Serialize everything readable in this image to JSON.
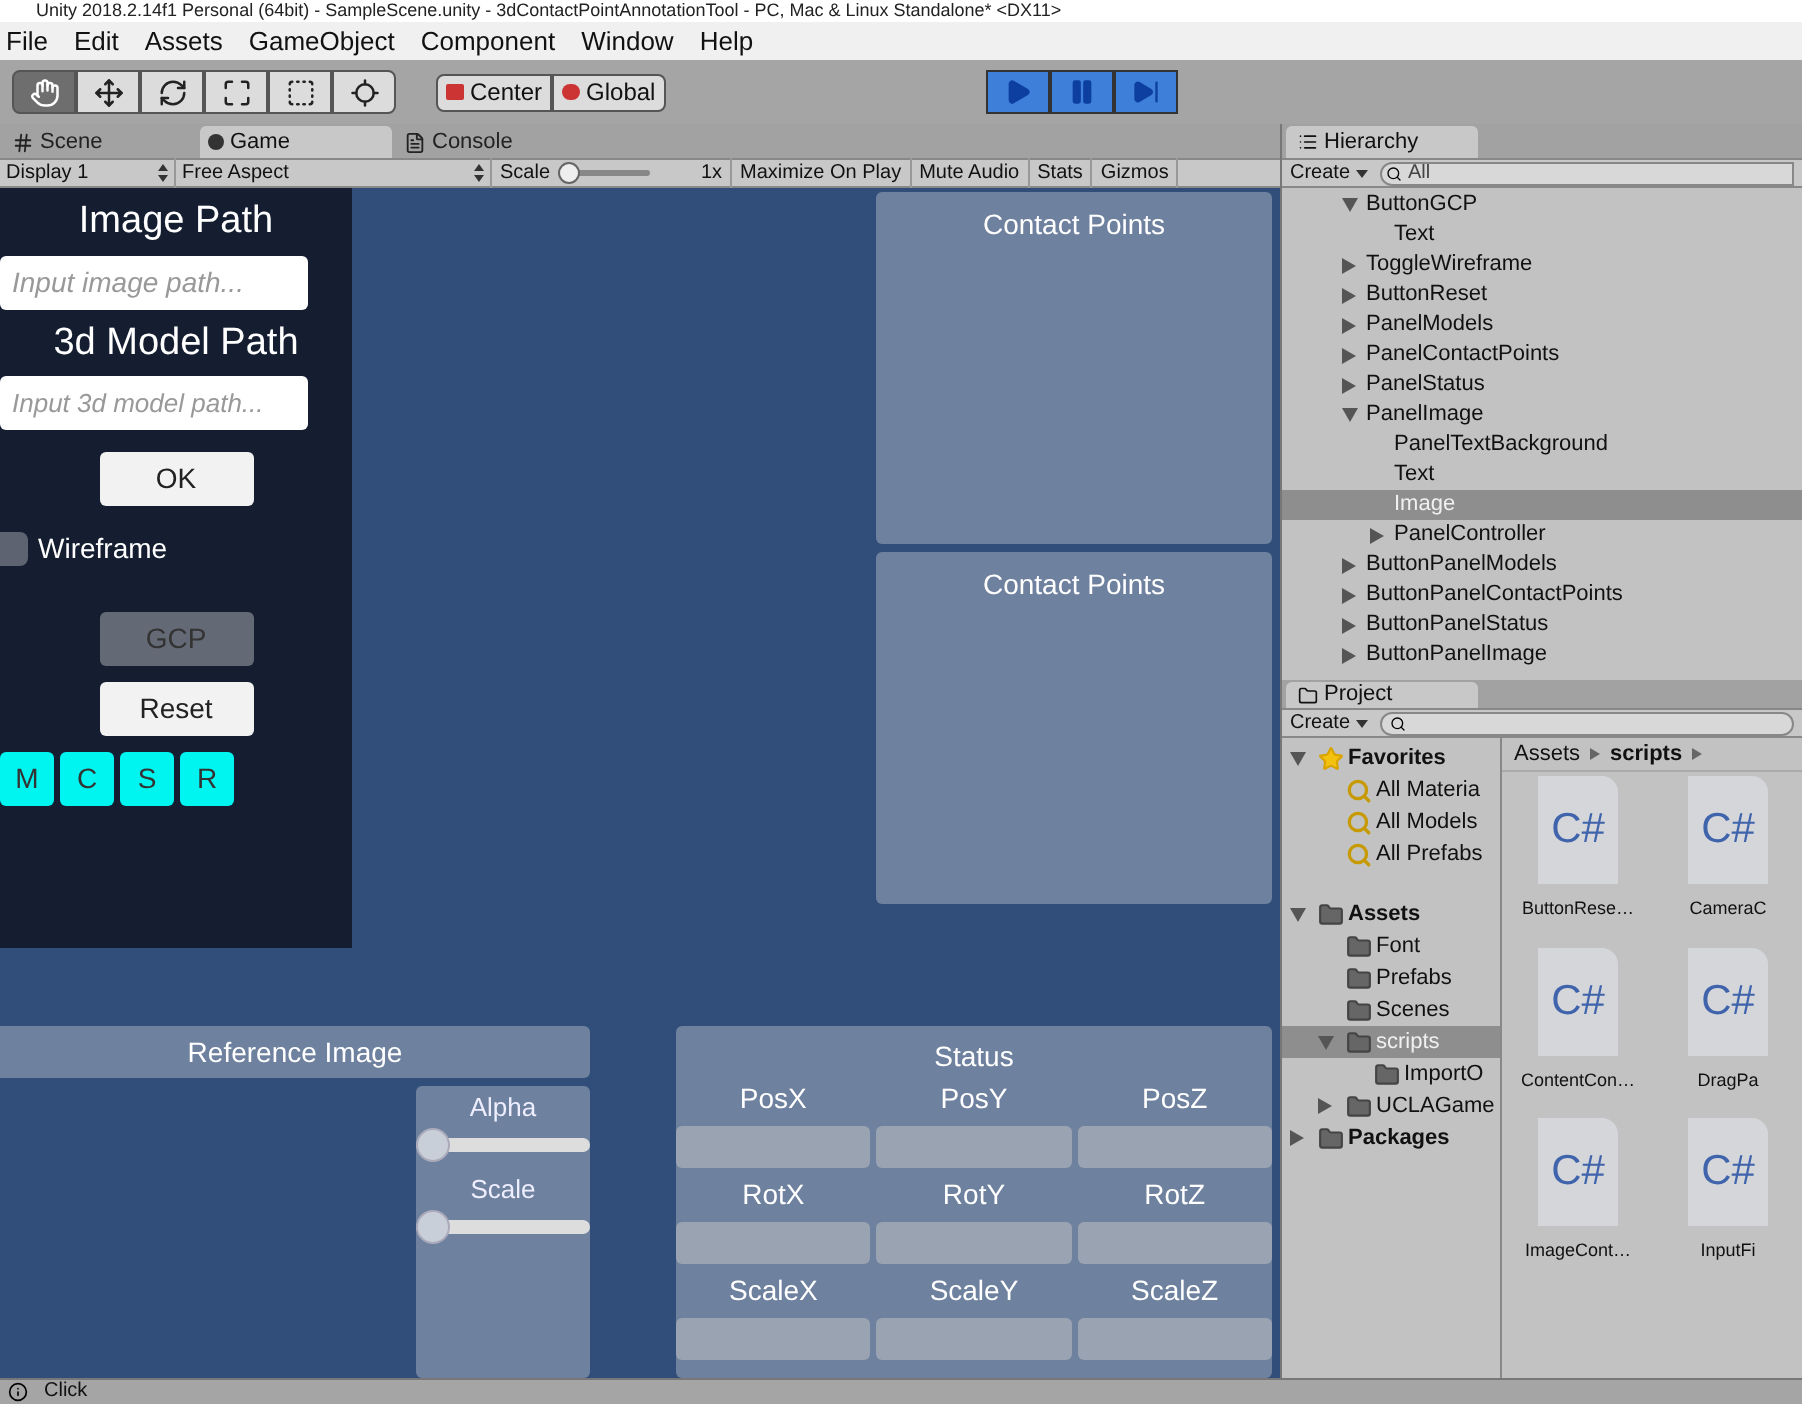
{
  "window": {
    "title": "Unity 2018.2.14f1 Personal (64bit) - SampleScene.unity - 3dContactPointAnnotationTool - PC, Mac & Linux Standalone* <DX11>"
  },
  "menu": [
    "File",
    "Edit",
    "Assets",
    "GameObject",
    "Component",
    "Window",
    "Help"
  ],
  "tools": [
    {
      "kind": "hand",
      "selected": true
    },
    {
      "kind": "move",
      "selected": false
    },
    {
      "kind": "rotate",
      "selected": false
    },
    {
      "kind": "scale",
      "selected": false
    },
    {
      "kind": "rect",
      "selected": false
    },
    {
      "kind": "transform",
      "selected": false
    }
  ],
  "pivot_buttons": [
    {
      "kind": "pivot",
      "label": "Center"
    },
    {
      "kind": "space",
      "label": "Global"
    }
  ],
  "play_controls": [
    {
      "kind": "play",
      "on": true
    },
    {
      "kind": "pause",
      "on": true
    },
    {
      "kind": "step",
      "on": true
    }
  ],
  "view_tabs": [
    {
      "kind": "scene",
      "label": "Scene",
      "selected": false
    },
    {
      "kind": "game",
      "label": "Game",
      "selected": true
    },
    {
      "kind": "console",
      "label": "Console",
      "selected": false
    }
  ],
  "game_toolbar": {
    "display": "Display 1",
    "aspect": "Free Aspect",
    "scale_label": "Scale",
    "scale": {
      "level": 0
    },
    "scale_reading": "1x",
    "buttons": [
      "Maximize On Play",
      "Mute Audio",
      "Stats",
      "Gizmos"
    ]
  },
  "game": {
    "image_path_label": "Image Path",
    "image_path": {
      "placeholder": "Input image path..."
    },
    "model_path_label": "3d Model Path",
    "model_path": {
      "placeholder": "Input 3d model path..."
    },
    "ok": "OK",
    "wireframe": {
      "label": "Wireframe",
      "checked": false
    },
    "gcp": {
      "label": "GCP",
      "disabled": true
    },
    "reset": {
      "label": "Reset",
      "disabled": false
    },
    "panel_buttons": [
      "M",
      "C",
      "S",
      "R"
    ],
    "contact_panels": [
      "Contact Points",
      "Contact Points"
    ],
    "reference_image": "Reference Image",
    "sliders": [
      {
        "label": "Alpha",
        "level": 0
      },
      {
        "label": "Scale",
        "level": 0
      }
    ],
    "status": {
      "title": "Status",
      "fields": [
        {
          "label": "PosX"
        },
        {
          "label": "PosY"
        },
        {
          "label": "PosZ"
        },
        {
          "label": "RotX"
        },
        {
          "label": "RotY"
        },
        {
          "label": "RotZ"
        },
        {
          "label": "ScaleX"
        },
        {
          "label": "ScaleY"
        },
        {
          "label": "ScaleZ"
        }
      ]
    }
  },
  "hierarchy": {
    "tab": "Hierarchy",
    "create": "Create",
    "search": {
      "placeholder": "All"
    },
    "items": [
      {
        "name": "ButtonGCP",
        "kind": "parent",
        "expanded": true,
        "selected": false,
        "children": [
          {
            "name": "Text",
            "kind": "leaf",
            "selected": false
          }
        ]
      },
      {
        "name": "ToggleWireframe",
        "kind": "parent",
        "expanded": false,
        "selected": false
      },
      {
        "name": "ButtonReset",
        "kind": "parent",
        "expanded": false,
        "selected": false
      },
      {
        "name": "PanelModels",
        "kind": "parent",
        "expanded": false,
        "selected": false
      },
      {
        "name": "PanelContactPoints",
        "kind": "parent",
        "expanded": false,
        "selected": false
      },
      {
        "name": "PanelStatus",
        "kind": "parent",
        "expanded": false,
        "selected": false
      },
      {
        "name": "PanelImage",
        "kind": "parent",
        "expanded": true,
        "selected": false,
        "children": [
          {
            "name": "PanelTextBackground",
            "kind": "leaf",
            "selected": false
          },
          {
            "name": "Text",
            "kind": "leaf",
            "selected": false
          },
          {
            "name": "Image",
            "kind": "leaf",
            "selected": true
          },
          {
            "name": "PanelController",
            "kind": "parent",
            "expanded": false,
            "selected": false
          }
        ]
      },
      {
        "name": "ButtonPanelModels",
        "kind": "parent",
        "expanded": false,
        "selected": false
      },
      {
        "name": "ButtonPanelContactPoints",
        "kind": "parent",
        "expanded": false,
        "selected": false
      },
      {
        "name": "ButtonPanelStatus",
        "kind": "parent",
        "expanded": false,
        "selected": false
      },
      {
        "name": "ButtonPanelImage",
        "kind": "parent",
        "expanded": false,
        "selected": false
      }
    ]
  },
  "project": {
    "tab": "Project",
    "create": "Create",
    "tree": [
      {
        "name": "Favorites",
        "kind": "favorites",
        "expanded": true,
        "selected": false,
        "children": [
          {
            "name": "All Materia",
            "kind": "search",
            "selected": false
          },
          {
            "name": "All Models",
            "kind": "search",
            "selected": false
          },
          {
            "name": "All Prefabs",
            "kind": "search",
            "selected": false
          }
        ]
      },
      {
        "name": "Assets",
        "kind": "root",
        "expanded": true,
        "selected": false,
        "children": [
          {
            "name": "Font",
            "kind": "folder",
            "selected": false
          },
          {
            "name": "Prefabs",
            "kind": "folder",
            "selected": false
          },
          {
            "name": "Scenes",
            "kind": "folder",
            "selected": false
          },
          {
            "name": "scripts",
            "kind": "folder",
            "expanded": true,
            "selected": true,
            "children": [
              {
                "name": "ImportO",
                "kind": "folder",
                "selected": false
              }
            ]
          },
          {
            "name": "UCLAGame",
            "kind": "folder",
            "expanded": false,
            "selected": false
          }
        ]
      },
      {
        "name": "Packages",
        "kind": "root",
        "expanded": false,
        "selected": false
      }
    ],
    "breadcrumb": [
      "Assets",
      "scripts"
    ],
    "files": [
      {
        "glyph": "C#",
        "name": "ButtonRese…"
      },
      {
        "glyph": "C#",
        "name": "CameraC"
      },
      {
        "glyph": "C#",
        "name": "ContentCon…"
      },
      {
        "glyph": "C#",
        "name": "DragPa"
      },
      {
        "glyph": "C#",
        "name": "ImageCont…"
      },
      {
        "glyph": "C#",
        "name": "InputFi"
      }
    ]
  },
  "status_bar": {
    "message": "Click"
  }
}
